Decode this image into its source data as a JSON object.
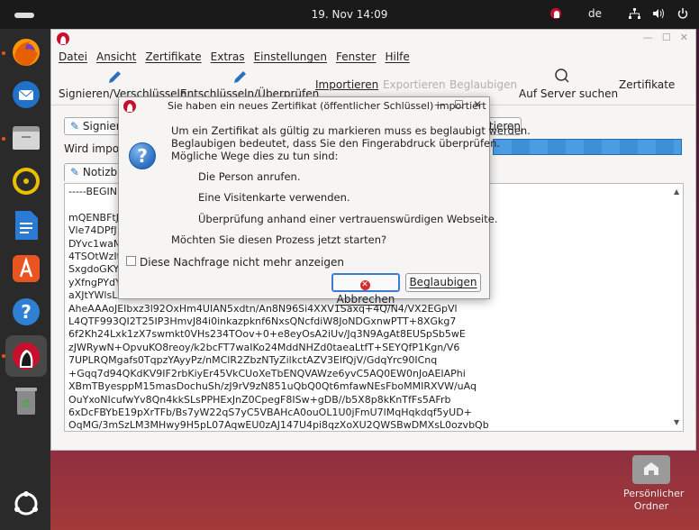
{
  "topbar": {
    "clock": "19. Nov  14:09",
    "language": "de"
  },
  "dock": {
    "items": [
      {
        "name": "firefox-icon",
        "color": "#e66000"
      },
      {
        "name": "thunderbird-icon",
        "color": "#1f72c8"
      },
      {
        "name": "files-icon",
        "color": "#8e8e8e"
      },
      {
        "name": "rhythmbox-icon",
        "color": "#e3b500"
      },
      {
        "name": "writer-icon",
        "color": "#1b6ac0"
      },
      {
        "name": "app-center-icon",
        "color": "#e95420"
      },
      {
        "name": "help-icon",
        "color": "#2f7fd2"
      },
      {
        "name": "kleopatra-icon",
        "color": "#c8102e"
      },
      {
        "name": "trash-icon",
        "color": "#7a7a7a"
      },
      {
        "name": "show-apps-icon",
        "color": "#ffffff"
      }
    ]
  },
  "window": {
    "menu": [
      "Datei",
      "Ansicht",
      "Zertifikate",
      "Extras",
      "Einstellungen",
      "Fenster",
      "Hilfe"
    ],
    "toolbar": {
      "sign_encrypt": "Signieren/Verschlüsseln",
      "decrypt_verify": "Entschlüsseln/Überprüfen",
      "import": "Importieren",
      "export": "Exportieren",
      "certify": "Beglaubigen",
      "lookup": "Auf Server suchen",
      "certificates": "Zertifikate"
    },
    "content": {
      "sign_button_partial": "Signiere",
      "status_partial": "Wird import",
      "import_button_partial": "rtieren",
      "notepad_tab_partial": "Notizbl",
      "key_lines": [
        "-----BEGIN P",
        "",
        "mQENBFtJ",
        "Vle74DPfJ",
        "DYvc1waM",
        "4TSOtWzIt",
        "SxgdoGKY",
        "yXfngPYdY",
        "aXJtYWlsL",
        "AheAAAoJEIbxz3l92OxHm4UIAN5xdtn/An8N96Si4XXV1Saxq+4Q/N4/VX2EGpVl",
        "L4QTF993QI2T25IP3HmvJ84i0inkazpknf6NxsQNcfdiW8JoNDGxnwPTT+8XGkg7",
        "6f2Kh24Lxk1zX7swmkt0VHs234TOov+0+e8eyOsA2iUv/Jq3N9AgAt8EUSpSb5wE",
        "zJWRywN+OpvuKO8reoy/k2bcFT7waIKo24MddNHZd0taeaLtfT+SEYQfP1Kgn/V6",
        "7UPLRQMgafs0TqpzYAyyPz/nMClR2ZbzNTyZilkctAZV3ElfQjV/GdqYrc90ICnq",
        "+Gqq7d94QKdKV9IF2rbKiyEr45VkCUoXeTbENQVAWze6yvC5AQ0EW0nJoAEIAPhi",
        "XBmTByesppM15masDochuSh/zJ9rV9zN851uQbQ0Qt6mfawNEsFboMMIRXVW/uAq",
        "OuYxoNIcufwYv8Qn4kkSLsPPHExJnZ0CpegF8ISw+gDB//b5X8p8kKnTfFs5AFrb",
        "6xDcFBYbE19pXrTFb/Bs7yW22qS7yC5VBAHcA0ouOL1U0jFmU7lMqHqkdqf5yUD+",
        "OqMG/3mSzLM3MHwy9H5pL07AqwEU0zAJ147U4pi8qzXoXU2QWSBwDMXsL0ozvbQb"
      ]
    }
  },
  "dialog": {
    "title": "Sie haben ein neues Zertifikat (öffentlicher Schlüssel) importiert",
    "line1": "Um ein Zertifikat als gültig zu markieren muss es beglaubigt werden.",
    "line2": "Beglaubigen bedeutet, dass Sie den Fingerabdruck überprüfen.",
    "line3": "Mögliche Wege dies zu tun sind:",
    "option1": "Die Person anrufen.",
    "option2": "Eine Visitenkarte verwenden.",
    "option3": "Überprüfung anhand einer vertrauenswürdigen Webseite.",
    "question": "Möchten Sie diesen Prozess jetzt starten?",
    "checkbox_label": "Diese Nachfrage nicht mehr anzeigen",
    "cancel_label": "Abbrechen",
    "certify_label": "Beglaubigen"
  },
  "desktop": {
    "home_label_1": "Persönlicher",
    "home_label_2": "Ordner"
  }
}
